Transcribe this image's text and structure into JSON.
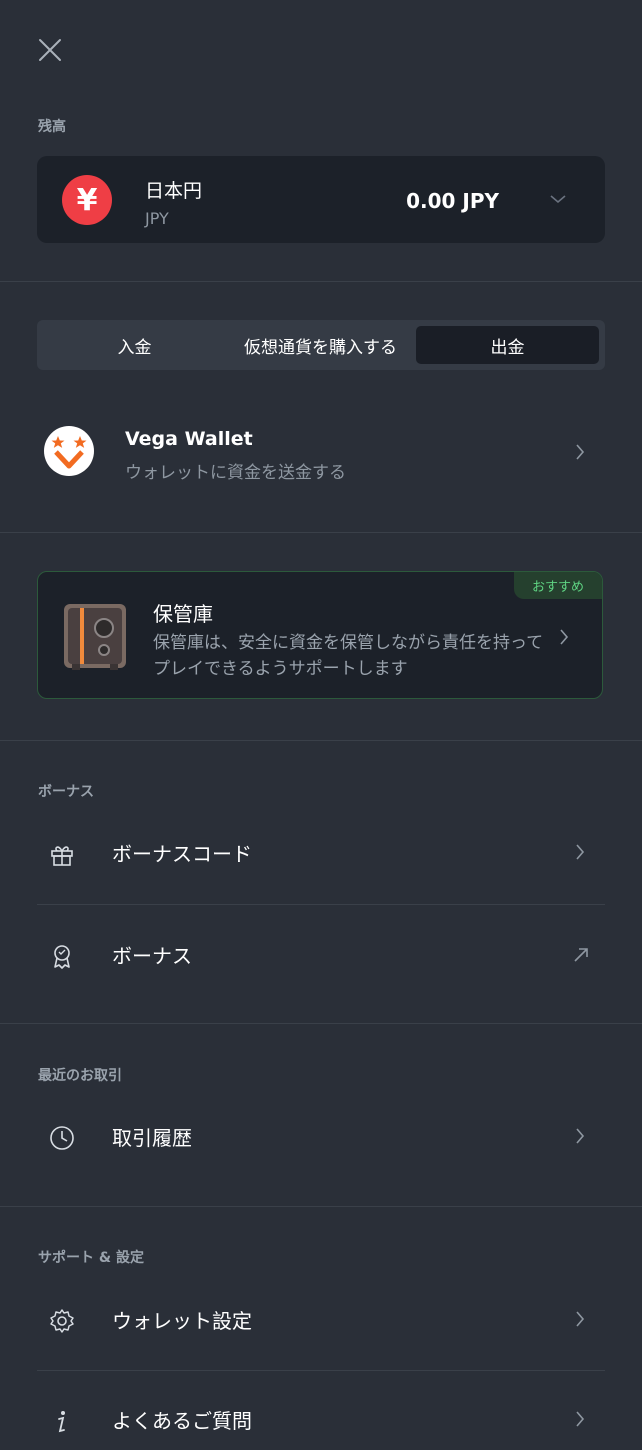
{
  "balance": {
    "section_label": "残高",
    "currency_symbol": "¥",
    "currency_name": "日本円",
    "currency_code": "JPY",
    "amount": "0.00 JPY"
  },
  "tabs": [
    {
      "label": "入金",
      "active": false
    },
    {
      "label": "仮想通貨を購入する",
      "active": false
    },
    {
      "label": "出金",
      "active": true
    }
  ],
  "vega": {
    "title": "Vega Wallet",
    "subtitle": "ウォレットに資金を送金する"
  },
  "vault": {
    "badge": "おすすめ",
    "title": "保管庫",
    "description": "保管庫は、安全に資金を保管しながら責任を持ってプレイできるようサポートします"
  },
  "bonus": {
    "section_label": "ボーナス",
    "items": [
      {
        "label": "ボーナスコード",
        "icon": "gift-icon"
      },
      {
        "label": "ボーナス",
        "icon": "badge-icon"
      }
    ]
  },
  "recent": {
    "section_label": "最近のお取引",
    "items": [
      {
        "label": "取引履歴",
        "icon": "clock-icon"
      }
    ]
  },
  "support": {
    "section_label": "サポート & 設定",
    "items": [
      {
        "label": "ウォレット設定",
        "icon": "gear-icon"
      },
      {
        "label": "よくあるご質問",
        "icon": "info-icon"
      }
    ]
  },
  "colors": {
    "background": "#2a2f38",
    "card": "#1c2129",
    "accent_red": "#ef3e45",
    "accent_green": "#5fd483"
  }
}
